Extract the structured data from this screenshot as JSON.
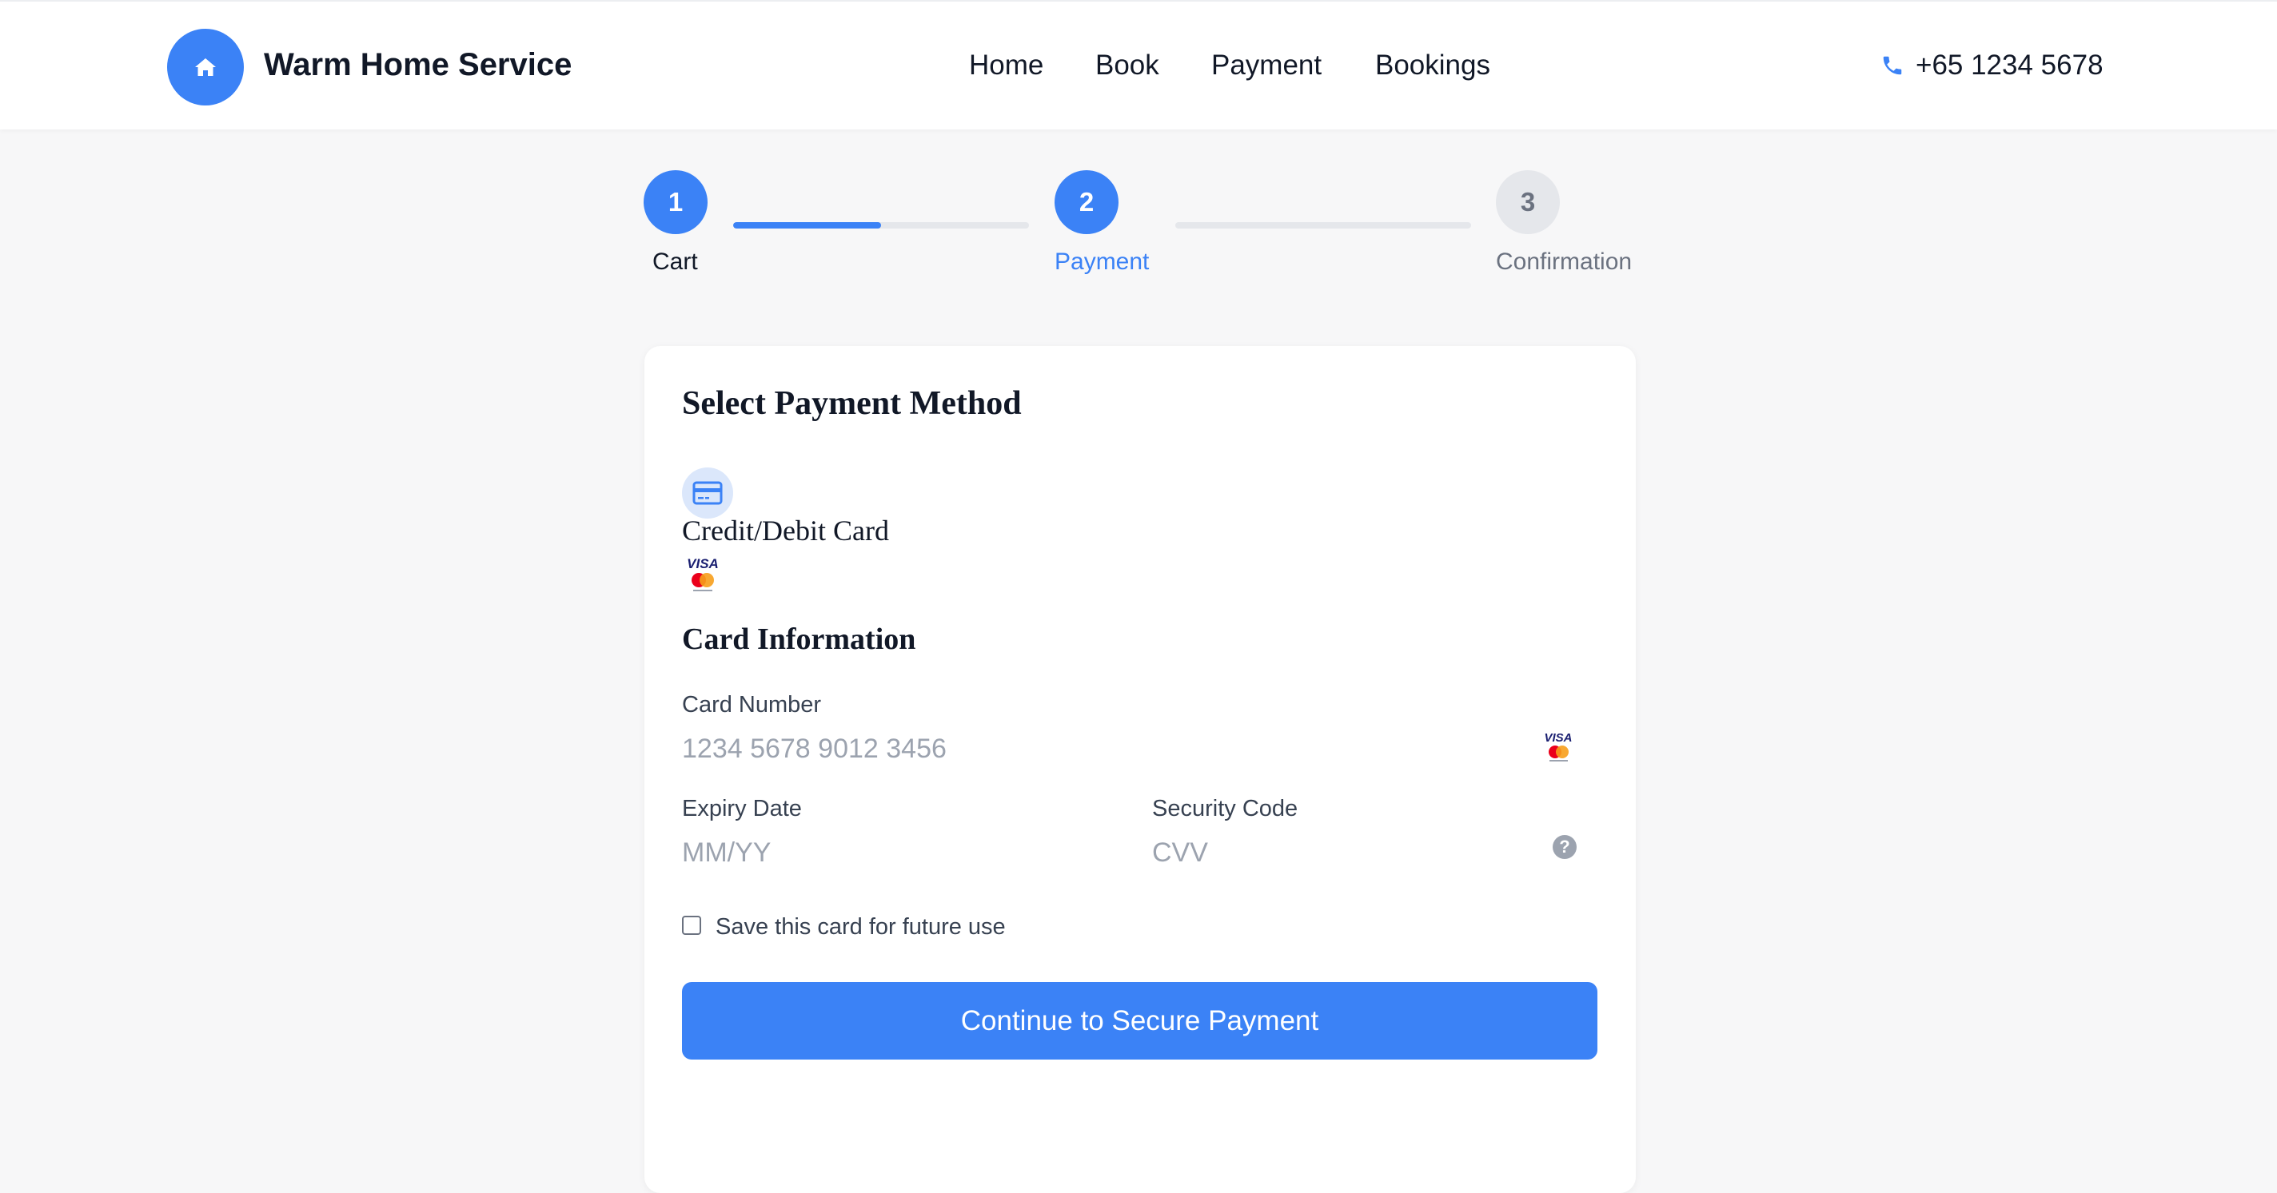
{
  "header": {
    "brand_name": "Warm Home Service",
    "nav": [
      "Home",
      "Book",
      "Payment",
      "Bookings"
    ],
    "phone": "+65 1234 5678"
  },
  "stepper": {
    "steps": [
      {
        "number": "1",
        "label": "Cart",
        "state": "completed"
      },
      {
        "number": "2",
        "label": "Payment",
        "state": "active"
      },
      {
        "number": "3",
        "label": "Confirmation",
        "state": "upcoming"
      }
    ],
    "progress": [
      0.5,
      0
    ]
  },
  "payment": {
    "title": "Select Payment Method",
    "method_label": "Credit/Debit Card",
    "card_info_title": "Card Information",
    "card_number_label": "Card Number",
    "card_number_placeholder": "1234 5678 9012 3456",
    "expiry_label": "Expiry Date",
    "expiry_placeholder": "MM/YY",
    "security_label": "Security Code",
    "security_placeholder": "CVV",
    "help_glyph": "?",
    "save_card_label": "Save this card for future use",
    "continue_label": "Continue to Secure Payment"
  },
  "colors": {
    "accent": "#3b82f6",
    "inactive": "#e5e7eb",
    "background": "#f7f7f8"
  },
  "icons": [
    "home-icon",
    "phone-icon",
    "credit-card-icon",
    "visa-mastercard-icon",
    "question-circle-icon"
  ]
}
